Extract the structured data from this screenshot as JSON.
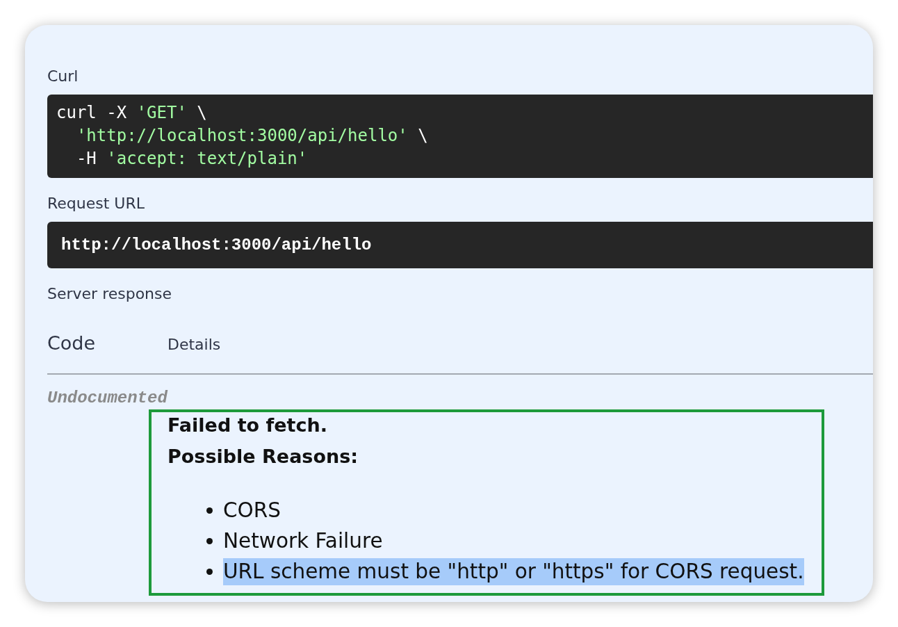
{
  "curl": {
    "label": "Curl",
    "lines": [
      [
        {
          "kind": "plain",
          "text": "curl -X "
        },
        {
          "kind": "string",
          "text": "'GET'"
        },
        {
          "kind": "plain",
          "text": " \\"
        }
      ],
      [
        {
          "kind": "string",
          "text": "  'http://localhost:3000/api/hello'"
        },
        {
          "kind": "plain",
          "text": " \\"
        }
      ],
      [
        {
          "kind": "plain",
          "text": "  -H "
        },
        {
          "kind": "string",
          "text": "'accept: text/plain'"
        }
      ]
    ]
  },
  "request_url": {
    "label": "Request URL",
    "value": "http://localhost:3000/api/hello"
  },
  "server_response": {
    "label": "Server response",
    "columns": [
      "Code",
      "Details"
    ],
    "rows": [
      {
        "code": "Undocumented",
        "details": {
          "title": "Failed to fetch.",
          "subtitle": "Possible Reasons:",
          "reasons": [
            {
              "text": "CORS",
              "highlighted": false
            },
            {
              "text": "Network Failure",
              "highlighted": false
            },
            {
              "text": "URL scheme must be \"http\" or \"https\" for CORS request.",
              "highlighted": true
            }
          ]
        }
      }
    ]
  }
}
